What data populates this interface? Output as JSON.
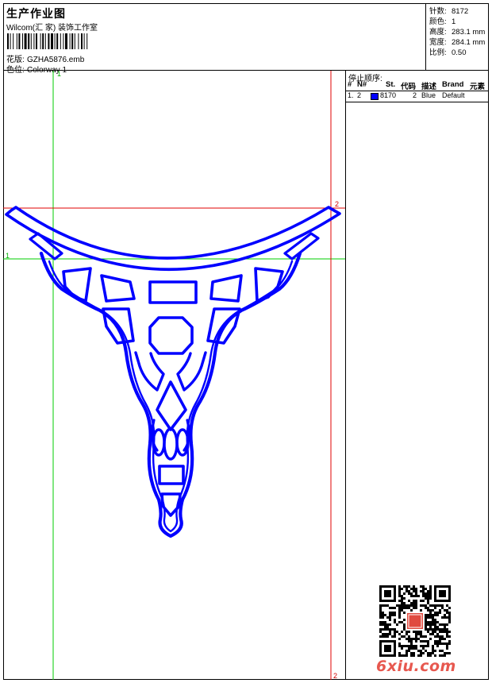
{
  "header": {
    "title": "生产作业图",
    "studio": "Wilcom(汇 家) 装饰工作室",
    "design_label": "花版:",
    "design_file": "GZHA5876.emb",
    "colorway_label": "色位:",
    "colorway": "Colorway 1"
  },
  "stats": [
    {
      "label": "针数:",
      "value": "8172"
    },
    {
      "label": "颜色:",
      "value": "1"
    },
    {
      "label": "高度:",
      "value": "283.1 mm"
    },
    {
      "label": "宽度:",
      "value": "284.1 mm"
    },
    {
      "label": "比例:",
      "value": "0.50"
    }
  ],
  "guides": {
    "green_label_top": "1",
    "green_label_side": "1",
    "red_label_top": "2",
    "red_label_bottom": "2"
  },
  "stop_sequence": {
    "title": "停止顺序:",
    "columns": [
      "#",
      "N#",
      "St.",
      "代码",
      "描述",
      "Brand",
      "元素"
    ],
    "rows": [
      {
        "index": "1.",
        "needle": "2",
        "color": "#0000ff",
        "stitches": "8170",
        "code": "2",
        "description": "Blue",
        "brand": "Default"
      }
    ]
  },
  "colors": {
    "thread": "#0000ff",
    "guide_green": "#00cc00",
    "guide_red": "#e00000",
    "watermark": "#e7584f"
  },
  "watermark": {
    "text": "6xiu.com",
    "seal_text": "汇家绣花"
  }
}
